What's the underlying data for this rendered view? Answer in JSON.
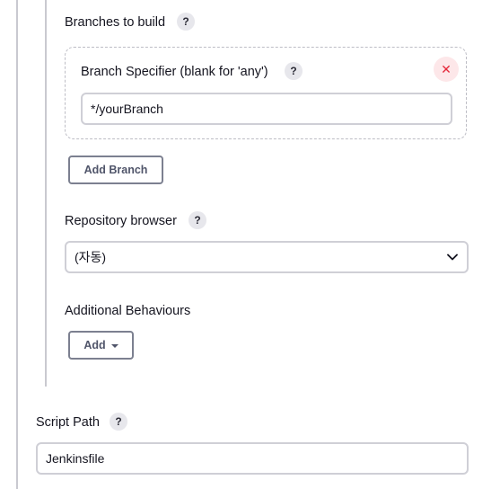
{
  "branches": {
    "section_label": "Branches to build",
    "help_glyph": "?",
    "specifier_label": "Branch Specifier (blank for 'any')",
    "specifier_value": "*/yourBranch",
    "delete_glyph": "✕",
    "add_branch_label": "Add Branch"
  },
  "repository_browser": {
    "label": "Repository browser",
    "selected": "(자동)"
  },
  "additional_behaviours": {
    "label": "Additional Behaviours",
    "add_label": "Add"
  },
  "script_path": {
    "label": "Script Path",
    "value": "Jenkinsfile"
  },
  "colors": {
    "delete_accent": "#e5283a",
    "border": "#cfcfd6",
    "button_border": "#7c8090"
  },
  "icons": {
    "help": "help-icon",
    "delete": "close-icon",
    "dropdown": "chevron-down-icon",
    "menu_caret": "caret-down-icon"
  }
}
